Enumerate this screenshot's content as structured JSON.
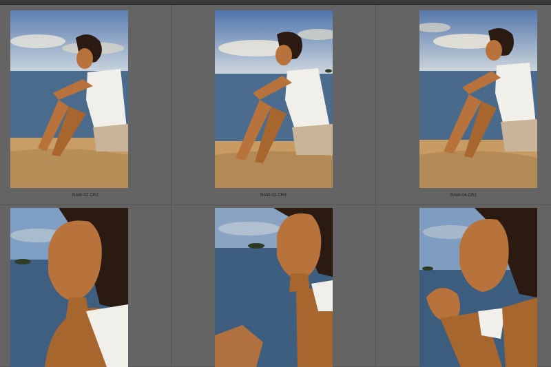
{
  "grid": {
    "cells": [
      {
        "filename": "RAW-02.CR2",
        "scene": "seated-beach"
      },
      {
        "filename": "RAW-03.CR2",
        "scene": "seated-beach"
      },
      {
        "filename": "RAW-04.CR2",
        "scene": "seated-beach"
      },
      {
        "filename": "",
        "scene": "portrait-closeup"
      },
      {
        "filename": "",
        "scene": "portrait-closeup"
      },
      {
        "filename": "",
        "scene": "portrait-closeup"
      }
    ]
  },
  "colors": {
    "cell_bg": "#646464",
    "caption_text": "#1a1a1a",
    "sky": "#9fb9d6",
    "sea": "#3f5f80",
    "sand": "#c69a62",
    "skin": "#b8733d",
    "dress": "#f1efe9",
    "hair": "#2a1a12"
  }
}
